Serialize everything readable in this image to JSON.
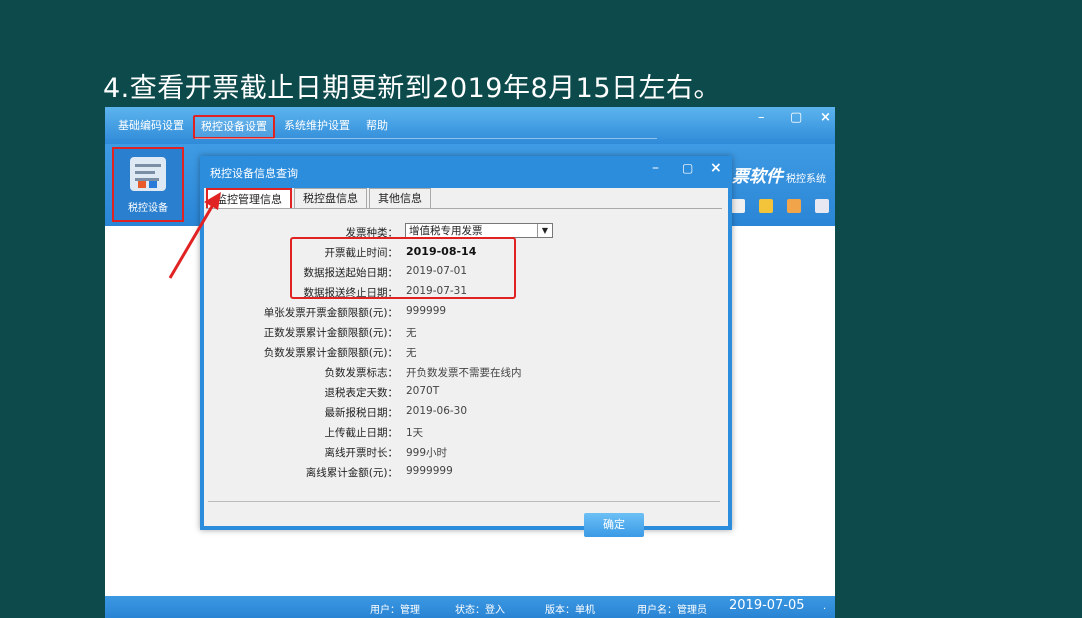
{
  "slide": {
    "title": "4.查看开票截止日期更新到2019年8月15日左右。"
  },
  "app": {
    "menu": [
      {
        "label": "基础编码设置",
        "active": false
      },
      {
        "label": "税控设备设置",
        "active": true
      },
      {
        "label": "系统维护设置",
        "active": false
      },
      {
        "label": "帮助",
        "active": false
      }
    ],
    "window_controls": {
      "minimize": "–",
      "restore": "▢",
      "close": "×"
    },
    "left_tile_label": "税控设备",
    "brand": "票软件",
    "brand_sub": "税控系统",
    "status": {
      "user": "用户：管理",
      "mode": "状态：登入",
      "edition": "版本：单机",
      "account": "用户名：管理员",
      "date": "2019-07-05",
      "tail": "."
    }
  },
  "dialog": {
    "title": "税控设备信息查询",
    "controls": {
      "minimize": "–",
      "restore": "▢",
      "close": "×"
    },
    "tabs": [
      {
        "label": "监控管理信息",
        "active": true
      },
      {
        "label": "税控盘信息",
        "active": false
      },
      {
        "label": "其他信息",
        "active": false
      }
    ],
    "invoice_type_label": "发票种类：",
    "invoice_type_value": "增值税专用发票",
    "fields": [
      {
        "label": "开票截止时间：",
        "value": "2019-08-14",
        "bold": true
      },
      {
        "label": "数据报送起始日期：",
        "value": "2019-07-01",
        "bold": false
      },
      {
        "label": "数据报送终止日期：",
        "value": "2019-07-31",
        "bold": false
      },
      {
        "label": "单张发票开票金额限额(元)：",
        "value": "999999",
        "bold": false
      },
      {
        "label": "正数发票累计金额限额(元)：",
        "value": "无",
        "bold": false
      },
      {
        "label": "负数发票累计金额限额(元)：",
        "value": "无",
        "bold": false
      },
      {
        "label": "负数发票标志：",
        "value": "开负数发票不需要在线内",
        "bold": false
      },
      {
        "label": "退税表定天数：",
        "value": "2070T",
        "bold": false
      },
      {
        "label": "最新报税日期：",
        "value": "2019-06-30",
        "bold": false
      },
      {
        "label": "上传截止日期：",
        "value": "1天",
        "bold": false
      },
      {
        "label": "离线开票时长：",
        "value": "999小时",
        "bold": false
      },
      {
        "label": "离线累计金额(元)：",
        "value": "9999999",
        "bold": false
      }
    ],
    "ok_label": "确定"
  },
  "colors": {
    "background": "#0d4a4b",
    "app_blue": "#2f8ad8",
    "highlight_red": "#e02222"
  }
}
